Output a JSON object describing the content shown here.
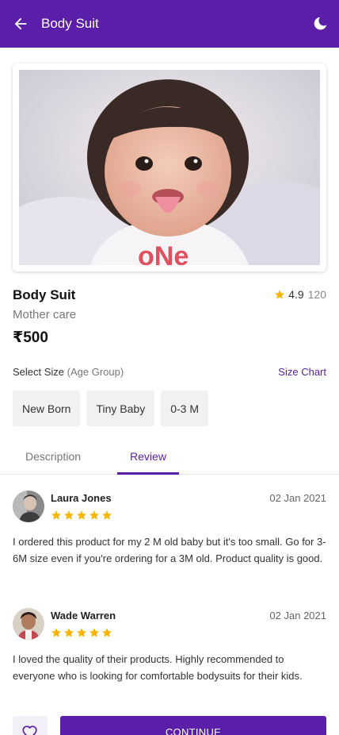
{
  "colors": {
    "brand": "#5a1ea8",
    "star": "#f6b400"
  },
  "appbar": {
    "title": "Body Suit",
    "back_icon": "arrow-left-icon",
    "theme_icon": "moon-icon"
  },
  "product": {
    "name": "Body Suit",
    "category": "Mother care",
    "price": "₹500",
    "rating": "4.9",
    "rating_count": "120",
    "image": "baby-photo"
  },
  "size": {
    "label": "Select Size",
    "label_hint": "(Age Group)",
    "chart_link": "Size Chart",
    "options": [
      "New Born",
      "Tiny Baby",
      "0-3 M"
    ]
  },
  "tabs": [
    {
      "label": "Description",
      "active": false
    },
    {
      "label": "Review",
      "active": true
    }
  ],
  "reviews": [
    {
      "name": "Laura Jones",
      "date": "02 Jan 2021",
      "stars": 5,
      "text": "I ordered this product for my 2 M old baby but it's too small. Go for 3-6M size even if you're ordering for a 3M old. Product quality is good."
    },
    {
      "name": "Wade Warren",
      "date": "02 Jan 2021",
      "stars": 5,
      "text": "I loved the quality of their products. Highly recommended to everyone who is looking for comfortable bodysuits for their kids."
    }
  ],
  "bottom": {
    "continue_label": "CONTINUE",
    "wishlist_icon": "heart-icon"
  }
}
